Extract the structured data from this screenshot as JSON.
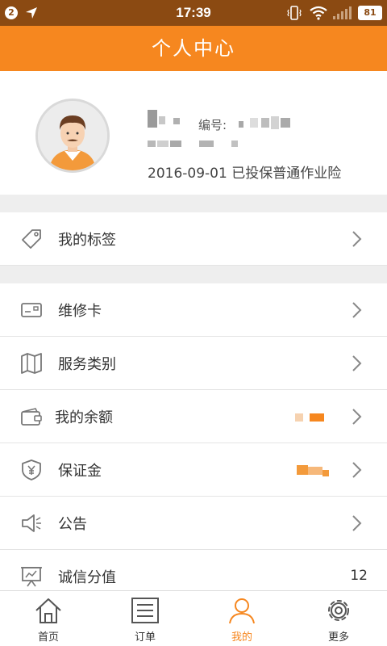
{
  "status_bar": {
    "notification_count": "2",
    "time": "17:39",
    "battery": "81",
    "icons": [
      "location-arrow-icon",
      "vibrate-icon",
      "wifi-icon",
      "signal-icon",
      "battery-icon"
    ]
  },
  "header": {
    "title": "个人中心"
  },
  "profile": {
    "id_label": "编号:",
    "insurance_text": "2016-09-01 已投保普通作业险"
  },
  "menu": {
    "tags": {
      "label": "我的标签",
      "icon": "tag-icon"
    },
    "items": [
      {
        "label": "维修卡",
        "icon": "card-icon"
      },
      {
        "label": "服务类别",
        "icon": "map-icon"
      },
      {
        "label": "我的余额",
        "icon": "wallet-icon"
      },
      {
        "label": "保证金",
        "icon": "yuan-shield-icon"
      },
      {
        "label": "公告",
        "icon": "speaker-icon"
      },
      {
        "label": "诚信分值",
        "icon": "chart-board-icon",
        "value": "12"
      }
    ]
  },
  "tabs": [
    {
      "label": "首页",
      "icon": "home-icon",
      "active": false
    },
    {
      "label": "订单",
      "icon": "list-icon",
      "active": false
    },
    {
      "label": "我的",
      "icon": "person-icon",
      "active": true
    },
    {
      "label": "更多",
      "icon": "gear-icon",
      "active": false
    }
  ],
  "colors": {
    "accent": "#f6871f",
    "status_bar": "#8b4a12",
    "separator": "#eeeeee"
  }
}
